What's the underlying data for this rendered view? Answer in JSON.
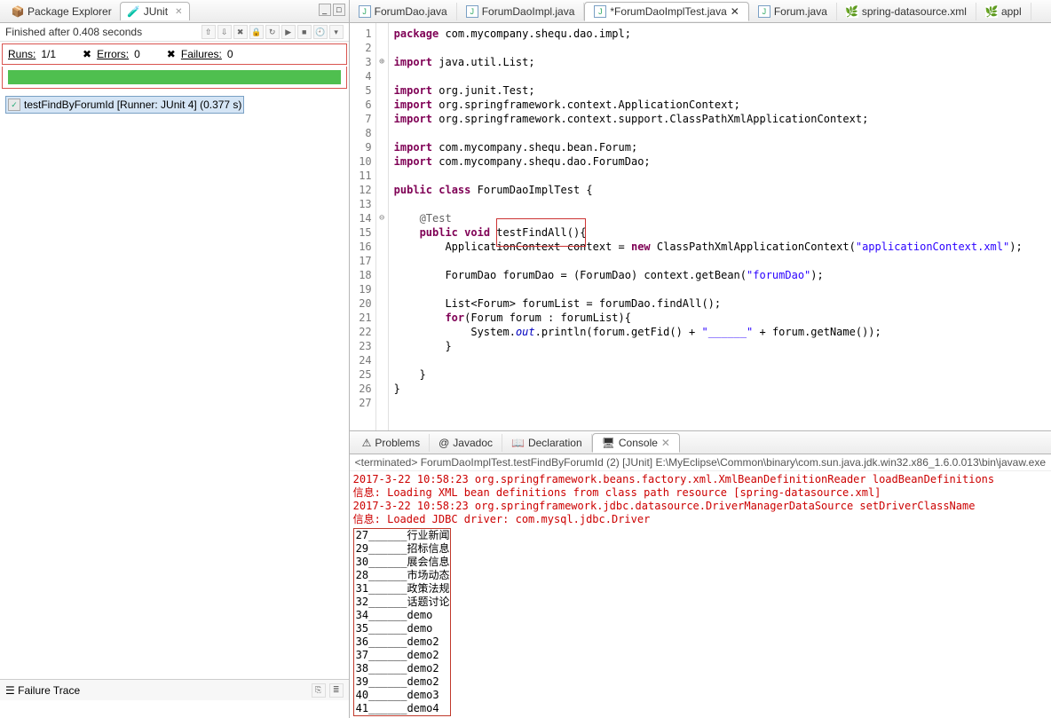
{
  "left": {
    "tabs": [
      {
        "label": "Package Explorer",
        "active": false
      },
      {
        "label": "JUnit",
        "active": true
      }
    ],
    "status": "Finished after 0.408 seconds",
    "stats": {
      "runs_label": "Runs:",
      "runs_value": "1/1",
      "errors_label": "Errors:",
      "errors_value": "0",
      "failures_label": "Failures:",
      "failures_value": "0"
    },
    "tree_item": "testFindByForumId [Runner: JUnit 4] (0.377 s)",
    "failure_trace_label": "Failure Trace"
  },
  "editor_tabs": [
    {
      "label": "ForumDao.java",
      "kind": "java"
    },
    {
      "label": "ForumDaoImpl.java",
      "kind": "java"
    },
    {
      "label": "*ForumDaoImplTest.java",
      "kind": "java",
      "active": true
    },
    {
      "label": "Forum.java",
      "kind": "java"
    },
    {
      "label": "spring-datasource.xml",
      "kind": "xml"
    },
    {
      "label": "appl",
      "kind": "xml",
      "truncated": true
    }
  ],
  "code": {
    "lines": [
      {
        "n": 1,
        "fold": "",
        "html": "<span class='kw'>package</span> com.mycompany.shequ.dao.impl;"
      },
      {
        "n": 2,
        "fold": "",
        "html": ""
      },
      {
        "n": 3,
        "fold": "⊕",
        "html": "<span class='kw'>import</span> java.util.List;"
      },
      {
        "n": 4,
        "fold": "",
        "html": ""
      },
      {
        "n": 5,
        "fold": "",
        "html": "<span class='kw'>import</span> org.junit.Test;"
      },
      {
        "n": 6,
        "fold": "",
        "html": "<span class='kw'>import</span> org.springframework.context.ApplicationContext;"
      },
      {
        "n": 7,
        "fold": "",
        "html": "<span class='kw'>import</span> org.springframework.context.support.ClassPathXmlApplicationContext;"
      },
      {
        "n": 8,
        "fold": "",
        "html": ""
      },
      {
        "n": 9,
        "fold": "",
        "html": "<span class='kw'>import</span> com.mycompany.shequ.bean.Forum;"
      },
      {
        "n": 10,
        "fold": "",
        "html": "<span class='kw'>import</span> com.mycompany.shequ.dao.ForumDao;"
      },
      {
        "n": 11,
        "fold": "",
        "html": ""
      },
      {
        "n": 12,
        "fold": "",
        "html": "<span class='kw'>public</span> <span class='kw'>class</span> ForumDaoImplTest {"
      },
      {
        "n": 13,
        "fold": "",
        "html": ""
      },
      {
        "n": 14,
        "fold": "⊖",
        "html": "    <span class='ann'>@Test</span>"
      },
      {
        "n": 15,
        "fold": "",
        "html": "    <span class='kw'>public</span> <span class='kw'>void</span> testFindAll(){",
        "hl": true
      },
      {
        "n": 16,
        "fold": "",
        "html": "        ApplicationContext context = <span class='kw'>new</span> ClassPathXmlApplicationContext(<span class='str'>\"applicationContext.xml\"</span>);"
      },
      {
        "n": 17,
        "fold": "",
        "html": ""
      },
      {
        "n": 18,
        "fold": "",
        "html": "        ForumDao forumDao = (ForumDao) context.getBean(<span class='str'>\"forumDao\"</span>);"
      },
      {
        "n": 19,
        "fold": "",
        "html": ""
      },
      {
        "n": 20,
        "fold": "",
        "html": "        List&lt;Forum&gt; forumList = forumDao.findAll();"
      },
      {
        "n": 21,
        "fold": "",
        "html": "        <span class='kw'>for</span>(Forum forum : forumList){"
      },
      {
        "n": 22,
        "fold": "",
        "html": "            System.<span class='it'>out</span>.println(forum.getFid() + <span class='str'>\"______\"</span> + forum.getName());"
      },
      {
        "n": 23,
        "fold": "",
        "html": "        }"
      },
      {
        "n": 24,
        "fold": "",
        "html": ""
      },
      {
        "n": 25,
        "fold": "",
        "html": "    }"
      },
      {
        "n": 26,
        "fold": "",
        "html": "}"
      },
      {
        "n": 27,
        "fold": "",
        "html": ""
      }
    ],
    "box1": {
      "top_line": 15,
      "left_ch": 16,
      "width_ch": 14,
      "height_lines": 2
    }
  },
  "bottom_tabs": [
    {
      "label": "Problems"
    },
    {
      "label": "Javadoc"
    },
    {
      "label": "Declaration"
    },
    {
      "label": "Console",
      "active": true
    }
  ],
  "console": {
    "header": "<terminated> ForumDaoImplTest.testFindByForumId (2) [JUnit] E:\\MyEclipse\\Common\\binary\\com.sun.java.jdk.win32.x86_1.6.0.013\\bin\\javaw.exe",
    "log": [
      {
        "red": true,
        "text": "2017-3-22 10:58:23 org.springframework.beans.factory.xml.XmlBeanDefinitionReader loadBeanDefinitions"
      },
      {
        "red": true,
        "text": "信息: Loading XML bean definitions from class path resource [spring-datasource.xml]"
      },
      {
        "red": true,
        "text": "2017-3-22 10:58:23 org.springframework.jdbc.datasource.DriverManagerDataSource setDriverClassName"
      },
      {
        "red": true,
        "text": "信息: Loaded JDBC driver: com.mysql.jdbc.Driver"
      }
    ],
    "output": [
      "27______行业新闻",
      "29______招标信息",
      "30______展会信息",
      "28______市场动态",
      "31______政策法规",
      "32______话题讨论",
      "34______demo",
      "35______demo",
      "36______demo2",
      "37______demo2",
      "38______demo2",
      "39______demo2",
      "40______demo3",
      "41______demo4"
    ]
  }
}
